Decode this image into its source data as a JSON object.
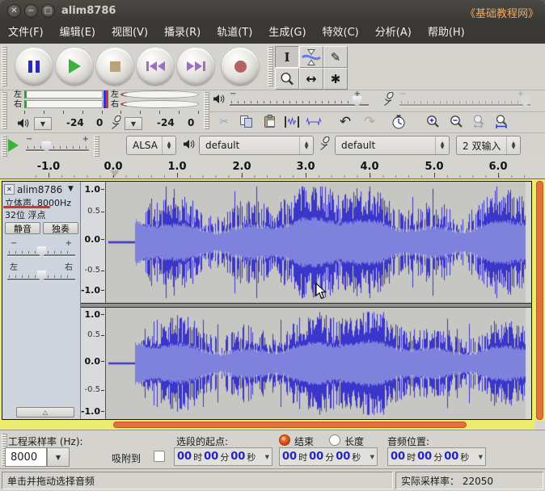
{
  "window": {
    "title": "alim8786",
    "watermark": "《基础教程网》"
  },
  "icons": {
    "close": "✕",
    "minimize": "−",
    "maximize": "□",
    "dropdown": "▼",
    "spin_up": "▲",
    "spin_down": "▼",
    "selection_tool": "I",
    "draw_tool": "✎",
    "timeshift_tool": "↔",
    "multi_tool": "✱",
    "cut": "✂",
    "undo": "↶",
    "redo": "↷",
    "collapse": "△",
    "track_close": "✕"
  },
  "menu": {
    "items": [
      "文件(F)",
      "编辑(E)",
      "视图(V)",
      "播录(R)",
      "轨道(T)",
      "生成(G)",
      "特效(C)",
      "分析(A)",
      "帮助(H)"
    ]
  },
  "meters": {
    "left": "左",
    "right": "右",
    "ticks": [
      "-24",
      "0"
    ]
  },
  "mixer": {
    "minus": "−",
    "plus": "+"
  },
  "device": {
    "host": "ALSA",
    "output": "default",
    "input": "default",
    "channels": "2 双输入"
  },
  "timeline": {
    "labels": [
      "-1.0",
      "0.0",
      "1.0",
      "2.0",
      "3.0",
      "4.0",
      "5.0",
      "6.0"
    ]
  },
  "track": {
    "name": "alim8786",
    "format_line": "立体声, 8000Hz",
    "depth_line": "32位 浮点",
    "mute": "静音",
    "solo": "独奏",
    "pan_left": "左",
    "pan_right": "右",
    "ruler": [
      "1.0",
      "0.5",
      "0.0",
      "-0.5",
      "-1.0"
    ]
  },
  "selection": {
    "rate_label": "工程采样率 (Hz):",
    "rate_value": "8000",
    "snap_label": "吸附到",
    "start_label": "选段的起点:",
    "end_option": "结束",
    "length_option": "长度",
    "position_label": "音频位置:",
    "time": {
      "h": "00",
      "h_unit": "时",
      "m": "00",
      "m_unit": "分",
      "s": "00",
      "s_unit": "秒"
    }
  },
  "status": {
    "message": "单击并拖动选择音频",
    "rate_info": "实际采样率： 22050"
  },
  "waveform": {
    "bg": "#c6c6c3",
    "edge": "#d6d6d2",
    "dark": "#3a35cb",
    "light": "#7e82dc"
  },
  "colors": {
    "titlebar": "#3a3834",
    "toolbar_bg": "#d5d3ce",
    "panel_blue": "#ced4de",
    "focus_yellow": "#ebeb6d",
    "scrollbar_orange": "#e5703f",
    "watermark_orange": "#f0a860",
    "wave_dark": "#3a35cb",
    "wave_light": "#7e82dc",
    "record_red": "#b26464",
    "play_green": "#3cb13c"
  }
}
